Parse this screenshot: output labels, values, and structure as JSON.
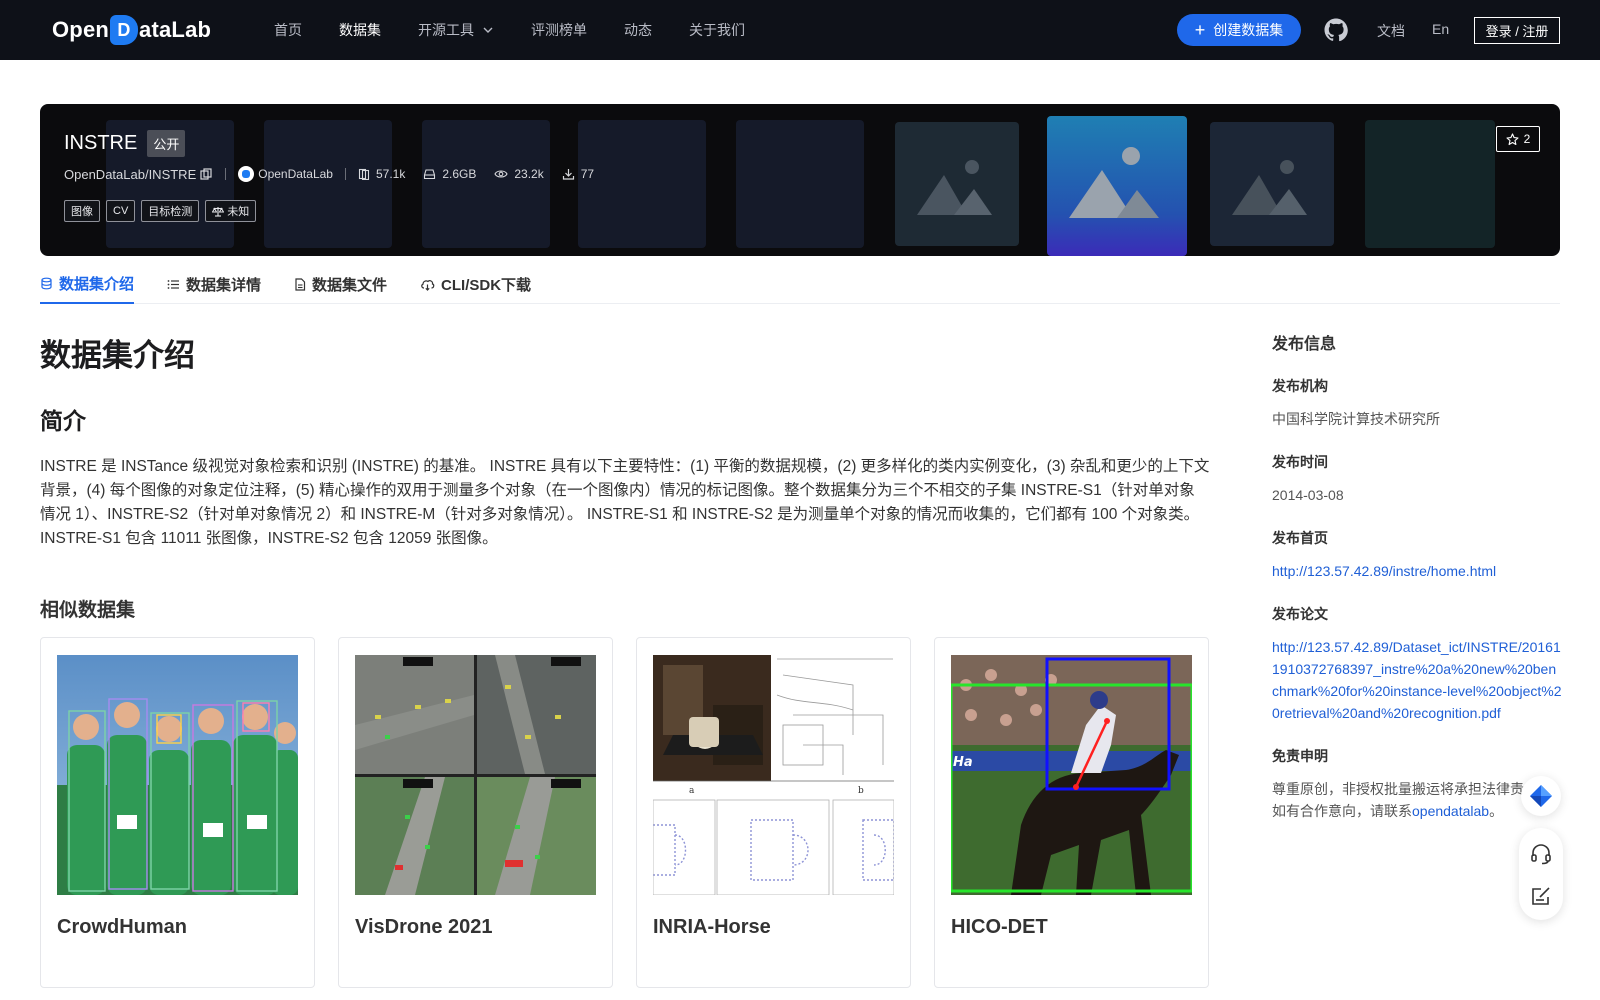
{
  "nav": {
    "logo_pre": "Open",
    "logo_mark": "D",
    "logo_post": "ataLab",
    "items": [
      {
        "label": "首页"
      },
      {
        "label": "数据集"
      },
      {
        "label": "开源工具"
      },
      {
        "label": "评测榜单"
      },
      {
        "label": "动态"
      },
      {
        "label": "关于我们"
      }
    ],
    "create_label": "创建数据集",
    "doc_label": "文档",
    "lang_label": "En",
    "login_label": "登录 / 注册"
  },
  "banner": {
    "title": "INSTRE",
    "public": "公开",
    "path": "OpenDataLab/INSTRE",
    "org": "OpenDataLab",
    "stats": {
      "files": "57.1k",
      "size": "2.6GB",
      "views": "23.2k",
      "downloads": "77"
    },
    "tags": [
      "图像",
      "CV",
      "目标检测",
      "未知"
    ],
    "stars": "2"
  },
  "tabs": [
    {
      "label": "数据集介绍"
    },
    {
      "label": "数据集详情"
    },
    {
      "label": "数据集文件"
    },
    {
      "label": "CLI/SDK下载"
    }
  ],
  "main": {
    "heading": "数据集介绍",
    "intro_heading": "简介",
    "description": "INSTRE 是 INSTance 级视觉对象检索和识别 (INSTRE) 的基准。 INSTRE 具有以下主要特性：(1) 平衡的数据规模，(2) 更多样化的类内实例变化，(3) 杂乱和更少的上下文背景，(4) 每个图像的对象定位注释，(5) 精心操作的双用于测量多个对象（在一个图像内）情况的标记图像。整个数据集分为三个不相交的子集 INSTRE-S1（针对单对象情况 1）、INSTRE-S2（针对单对象情况 2）和 INSTRE-M（针对多对象情况）。 INSTRE-S1 和 INSTRE-S2 是为测量单个对象的情况而收集的，它们都有 100 个对象类。 INSTRE-S1 包含 11011 张图像，INSTRE-S2 包含 12059 张图像。",
    "similar_heading": "相似数据集",
    "similar": [
      {
        "name": "CrowdHuman"
      },
      {
        "name": "VisDrone 2021"
      },
      {
        "name": "INRIA-Horse"
      },
      {
        "name": "HICO-DET"
      }
    ]
  },
  "side": {
    "title": "发布信息",
    "org_label": "发布机构",
    "org_value": "中国科学院计算技术研究所",
    "date_label": "发布时间",
    "date_value": "2014-03-08",
    "home_label": "发布首页",
    "home_value": "http://123.57.42.89/instre/home.html",
    "paper_label": "发布论文",
    "paper_value": "http://123.57.42.89/Dataset_ict/INSTRE/201611910372768397_instre%20a%20new%20benchmark%20for%20instance-level%20object%20retrieval%20and%20recognition.pdf",
    "disclaimer_label": "免责申明",
    "disclaimer_1": "尊重原创，非授权批量搬运将承担法律责任。",
    "disclaimer_2": "如有合作意向，请联系",
    "disclaimer_link": "opendatalab",
    "disclaimer_end": "。"
  },
  "colors": {
    "accent": "#1f68ea",
    "nav_bg": "#0e1118",
    "banner_bg": "#0b0b0d"
  }
}
